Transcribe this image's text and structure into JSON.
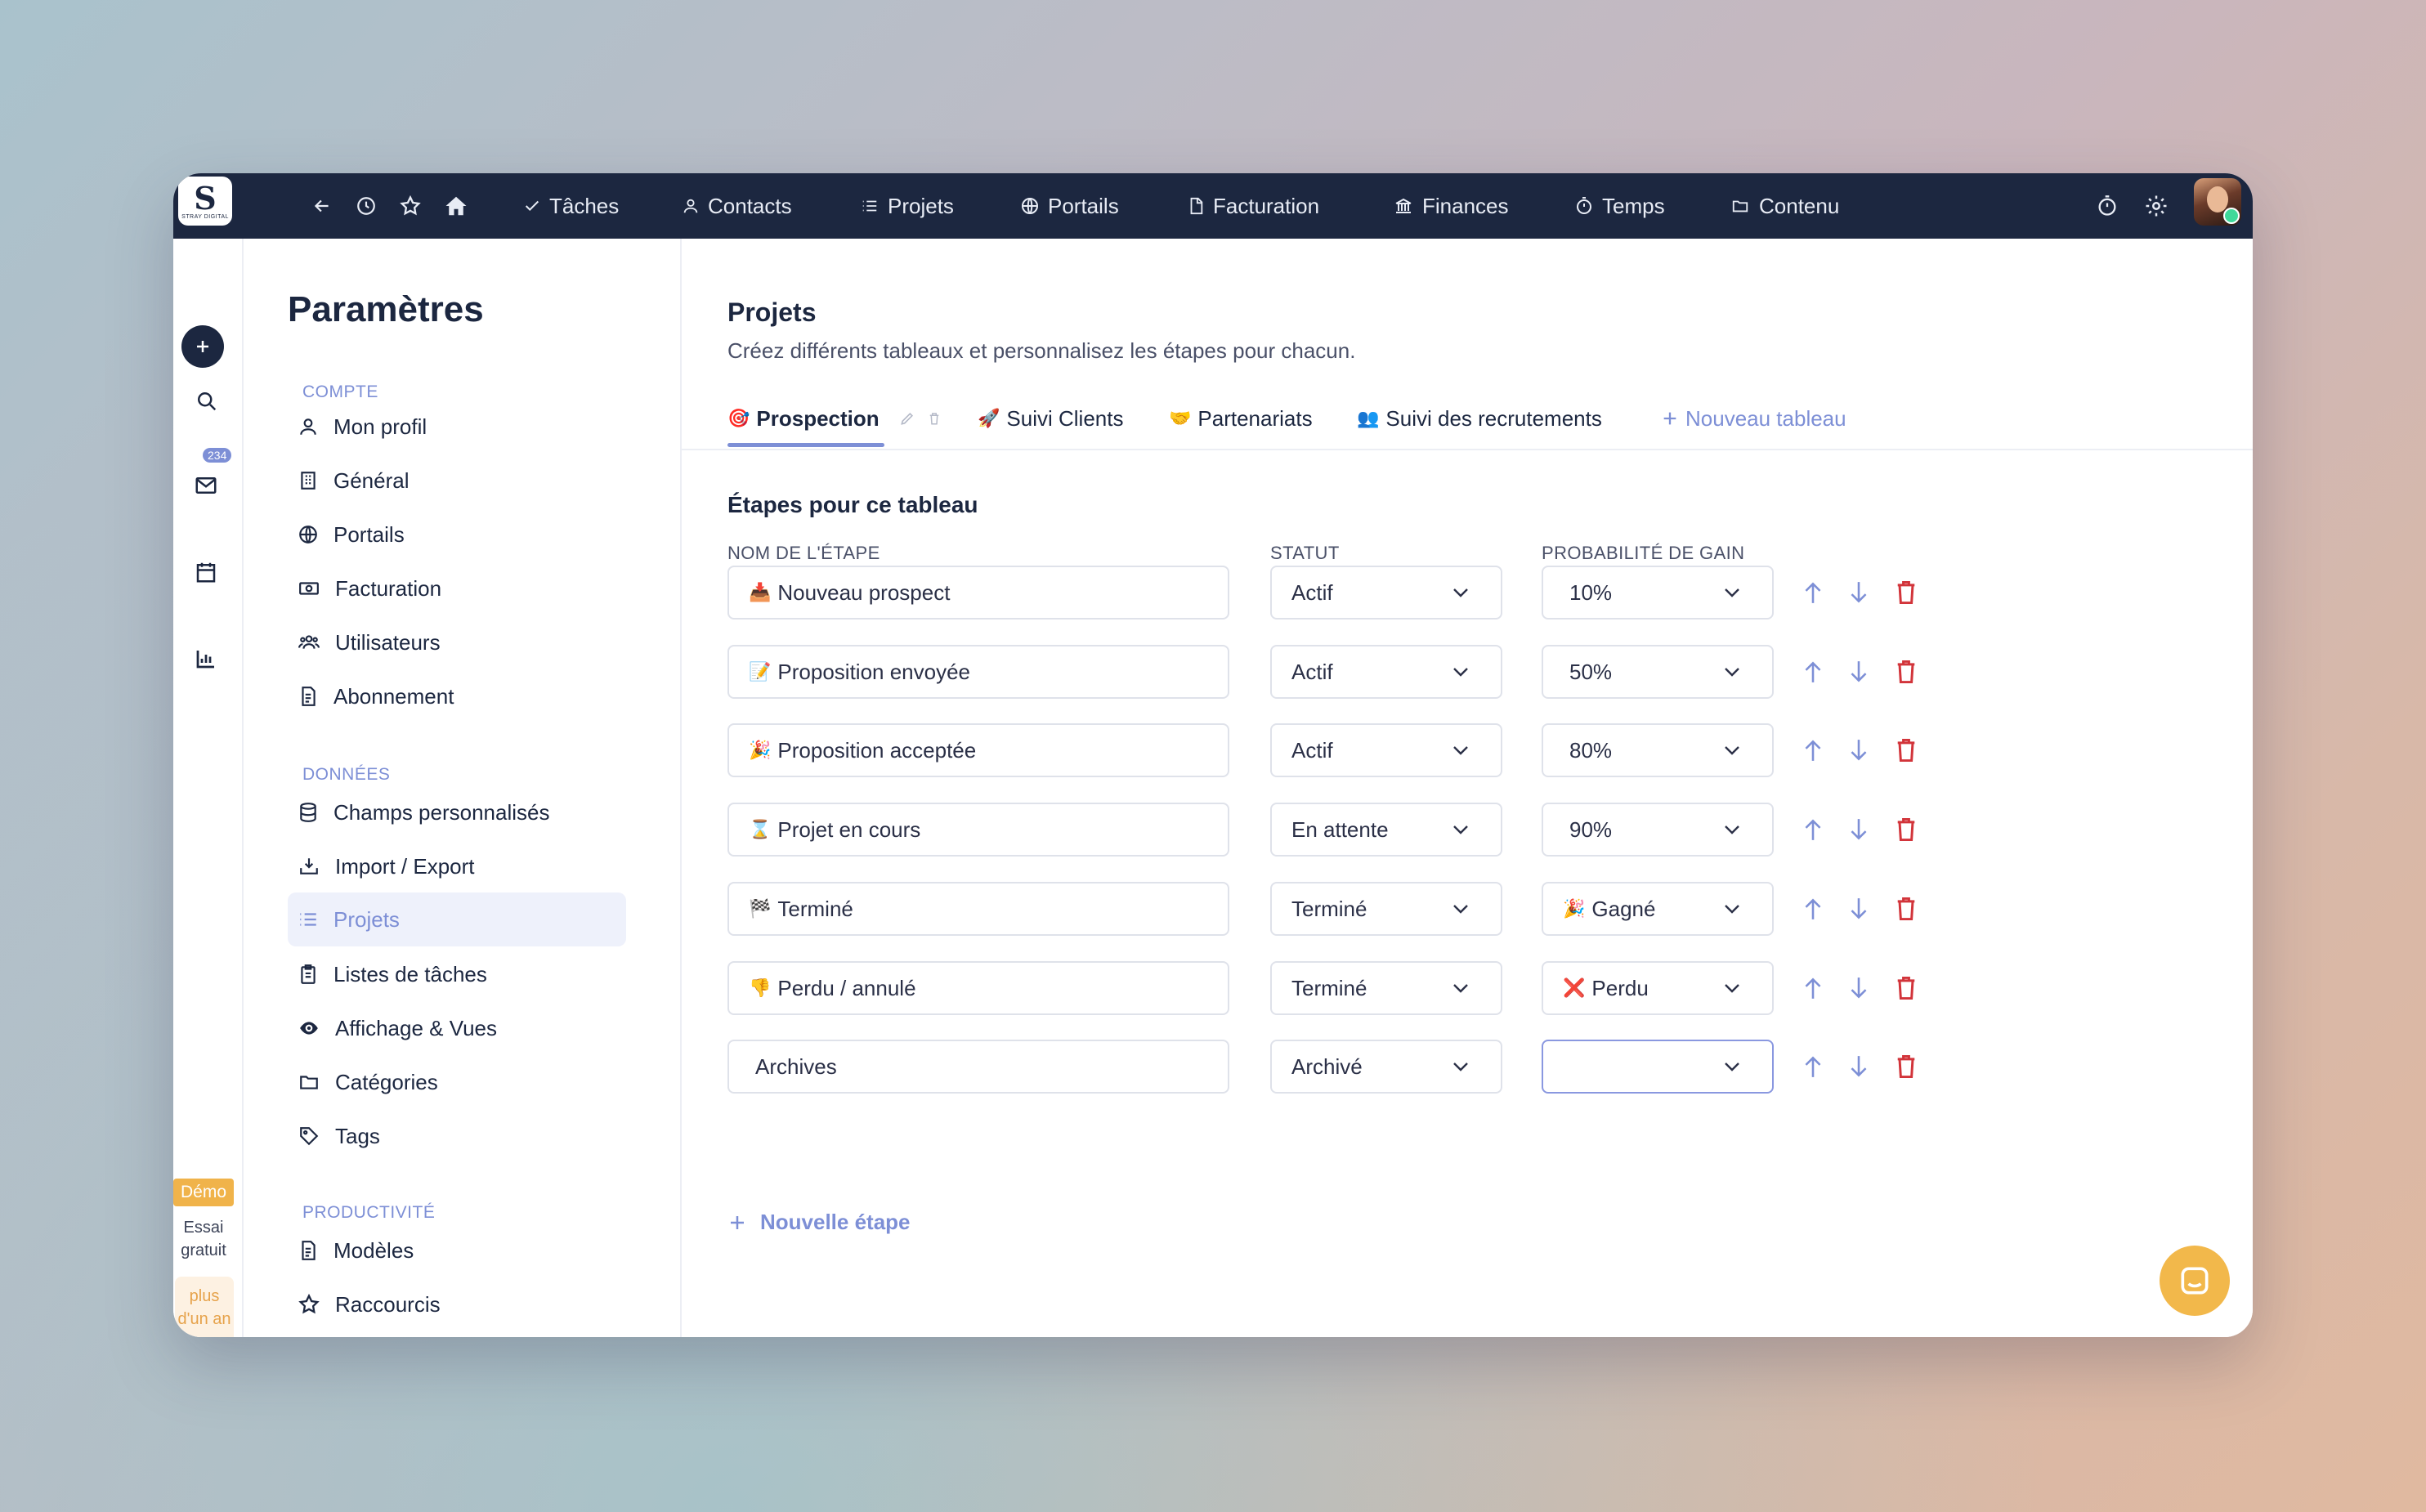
{
  "app": {
    "logo_text": "STRAY DIGITAL",
    "nav": [
      {
        "label": "Tâches",
        "icon": "check-icon"
      },
      {
        "label": "Contacts",
        "icon": "person-icon"
      },
      {
        "label": "Projets",
        "icon": "list-icon"
      },
      {
        "label": "Portails",
        "icon": "globe-icon"
      },
      {
        "label": "Facturation",
        "icon": "document-icon"
      },
      {
        "label": "Finances",
        "icon": "bank-icon"
      },
      {
        "label": "Temps",
        "icon": "stopwatch-icon"
      },
      {
        "label": "Contenu",
        "icon": "folder-icon"
      }
    ],
    "mail_badge": "234",
    "trial": {
      "demo": "Démo",
      "essai": "Essai gratuit",
      "duration": "plus d'un an"
    }
  },
  "settings": {
    "title": "Paramètres",
    "sections": [
      {
        "label": "COMPTE",
        "items": [
          {
            "label": "Mon profil",
            "icon": "user-icon"
          },
          {
            "label": "Général",
            "icon": "building-icon"
          },
          {
            "label": "Portails",
            "icon": "globe-icon"
          },
          {
            "label": "Facturation",
            "icon": "cash-icon"
          },
          {
            "label": "Utilisateurs",
            "icon": "users-icon"
          },
          {
            "label": "Abonnement",
            "icon": "receipt-icon"
          }
        ]
      },
      {
        "label": "DONNÉES",
        "items": [
          {
            "label": "Champs personnalisés",
            "icon": "database-icon"
          },
          {
            "label": "Import / Export",
            "icon": "import-icon"
          },
          {
            "label": "Projets",
            "icon": "list-icon",
            "active": true
          },
          {
            "label": "Listes de tâches",
            "icon": "clipboard-icon"
          },
          {
            "label": "Affichage & Vues",
            "icon": "eye-icon"
          },
          {
            "label": "Catégories",
            "icon": "folder-icon"
          },
          {
            "label": "Tags",
            "icon": "tag-icon"
          }
        ]
      },
      {
        "label": "PRODUCTIVITÉ",
        "items": [
          {
            "label": "Modèles",
            "icon": "template-icon"
          },
          {
            "label": "Raccourcis",
            "icon": "star-icon"
          }
        ]
      }
    ]
  },
  "main": {
    "title": "Projets",
    "subtitle": "Créez différents tableaux et personnalisez les étapes pour chacun.",
    "tabs": [
      {
        "label": "Prospection",
        "emoji": "🎯",
        "active": true
      },
      {
        "label": "Suivi Clients",
        "emoji": "🚀"
      },
      {
        "label": "Partenariats",
        "emoji": "🤝"
      },
      {
        "label": "Suivi des recrutements",
        "emoji": "👥"
      }
    ],
    "new_tab": "Nouveau tableau",
    "stages_title": "Étapes pour ce tableau",
    "columns": {
      "name": "NOM DE L'ÉTAPE",
      "status": "STATUT",
      "probability": "PROBABILITÉ DE GAIN"
    },
    "stages": [
      {
        "emoji": "📥",
        "name": "Nouveau prospect",
        "status": "Actif",
        "probability": "10%",
        "prob_emoji": ""
      },
      {
        "emoji": "📝",
        "name": "Proposition envoyée",
        "status": "Actif",
        "probability": "50%",
        "prob_emoji": ""
      },
      {
        "emoji": "🎉",
        "name": "Proposition acceptée",
        "status": "Actif",
        "probability": "80%",
        "prob_emoji": ""
      },
      {
        "emoji": "⌛",
        "name": "Projet en cours",
        "status": "En attente",
        "probability": "90%",
        "prob_emoji": ""
      },
      {
        "emoji": "🏁",
        "name": "Terminé",
        "status": "Terminé",
        "probability": "Gagné",
        "prob_emoji": "🎉"
      },
      {
        "emoji": "👎",
        "name": "Perdu / annulé",
        "status": "Terminé",
        "probability": "Perdu",
        "prob_emoji": "❌"
      },
      {
        "emoji": "",
        "name": "Archives",
        "status": "Archivé",
        "probability": "",
        "prob_emoji": ""
      }
    ],
    "add_stage": "Nouvelle étape"
  },
  "colors": {
    "navy": "#1c2740",
    "accent": "#7d8fd6",
    "danger": "#d2343a",
    "arrow": "#f0a43a",
    "chat": "#f2b84b"
  }
}
